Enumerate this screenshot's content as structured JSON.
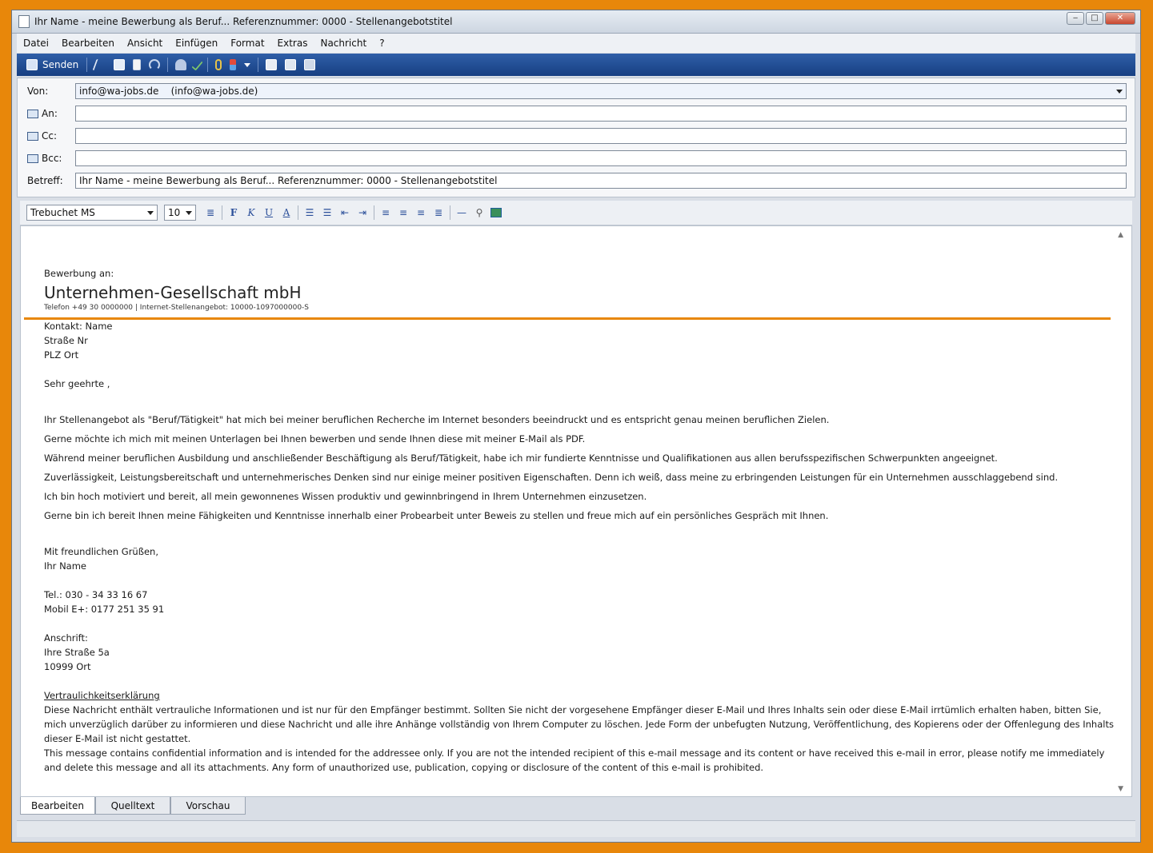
{
  "window": {
    "title": "Ihr Name - meine Bewerbung als Beruf... Referenznummer: 0000 - Stellenangebotstitel",
    "minimize": "‒",
    "maximize": "□",
    "close": "✕"
  },
  "menu": [
    "Datei",
    "Bearbeiten",
    "Ansicht",
    "Einfügen",
    "Format",
    "Extras",
    "Nachricht",
    "?"
  ],
  "toolbar": {
    "send_label": "Senden",
    "icons": [
      "cut-icon",
      "copy-icon",
      "paste-icon",
      "undo-icon",
      "address-book-icon",
      "spellcheck-icon",
      "attach-icon",
      "priority-icon",
      "dropdown-icon",
      "sign-icon",
      "encrypt-icon",
      "offline-icon"
    ]
  },
  "header": {
    "von_label": "Von:",
    "von_value": "info@wa-jobs.de    (info@wa-jobs.de)",
    "an_label": "An:",
    "an_value": "",
    "cc_label": "Cc:",
    "cc_value": "",
    "bcc_label": "Bcc:",
    "bcc_value": "",
    "betreff_label": "Betreff:",
    "betreff_value": "Ihr Name - meine Bewerbung als Beruf... Referenznummer: 0000 - Stellenangebotstitel"
  },
  "format": {
    "font": "Trebuchet MS",
    "size": "10"
  },
  "letter": {
    "intro": "Bewerbung an:",
    "company": "Unternehmen-Gesellschaft mbH",
    "company_sub": "Telefon +49 30 0000000 | Internet-Stellenangebot: 10000-1097000000-S",
    "contact_line": "Kontakt: Name",
    "street": "Straße Nr",
    "city": "PLZ Ort",
    "salutation": "Sehr geehrte ,",
    "paragraphs": [
      "Ihr Stellenangebot als \"Beruf/Tätigkeit\" hat mich bei meiner beruflichen Recherche im Internet besonders beeindruckt und es entspricht genau meinen beruflichen Zielen.",
      "Gerne möchte ich mich mit meinen Unterlagen bei Ihnen bewerben und sende Ihnen diese mit meiner E-Mail als PDF.",
      "Während meiner beruflichen Ausbildung und anschließender Beschäftigung als Beruf/Tätigkeit, habe ich mir fundierte Kenntnisse und Qualifikationen aus allen berufsspezifischen Schwerpunkten angeeignet.",
      "Zuverlässigkeit, Leistungsbereitschaft und unternehmerisches Denken sind nur einige meiner positiven Eigenschaften. Denn ich weiß, dass meine zu erbringenden Leistungen für ein Unternehmen ausschlaggebend sind.",
      "Ich bin hoch motiviert und bereit, all mein gewonnenes Wissen produktiv und gewinnbringend in Ihrem Unternehmen einzusetzen.",
      "Gerne bin ich bereit Ihnen meine Fähigkeiten und Kenntnisse innerhalb einer Probearbeit unter Beweis zu stellen und freue mich auf ein persönliches Gespräch mit Ihnen."
    ],
    "closing": "Mit freundlichen Grüßen,",
    "name": "Ihr Name",
    "tel": "Tel.: 030 - 34 33 16 67",
    "mobil": "Mobil E+: 0177 251 35 91",
    "address_label": "Anschrift:",
    "address_street": "Ihre Straße 5a",
    "address_city": "10999 Ort",
    "disclaimer_title": "Vertraulichkeitserklärung",
    "disclaimer_de": "Diese Nachricht enthält vertrauliche Informationen und ist nur für den Empfänger bestimmt. Sollten Sie nicht der vorgesehene Empfänger dieser E-Mail und Ihres Inhalts sein oder diese E-Mail irrtümlich erhalten haben, bitten Sie, mich unverzüglich darüber zu informieren und diese Nachricht und alle ihre Anhänge vollständig von Ihrem Computer zu löschen. Jede Form der unbefugten Nutzung, Veröffentlichung, des Kopierens oder der Offenlegung des Inhalts dieser E-Mail ist nicht gestattet.",
    "disclaimer_en": "This message contains confidential information and is intended for the addressee only. If you are not the intended recipient of this e-mail message and its content or have received this e-mail in error, please notify me immediately and delete this message and all its attachments. Any form of unauthorized use, publication, copying or disclosure of the content of this e-mail is prohibited."
  },
  "tabs": [
    "Bearbeiten",
    "Quelltext",
    "Vorschau"
  ],
  "colors": {
    "frame": "#e8870a",
    "toolbar": "#1f4a8f",
    "rule": "#e8870a"
  }
}
